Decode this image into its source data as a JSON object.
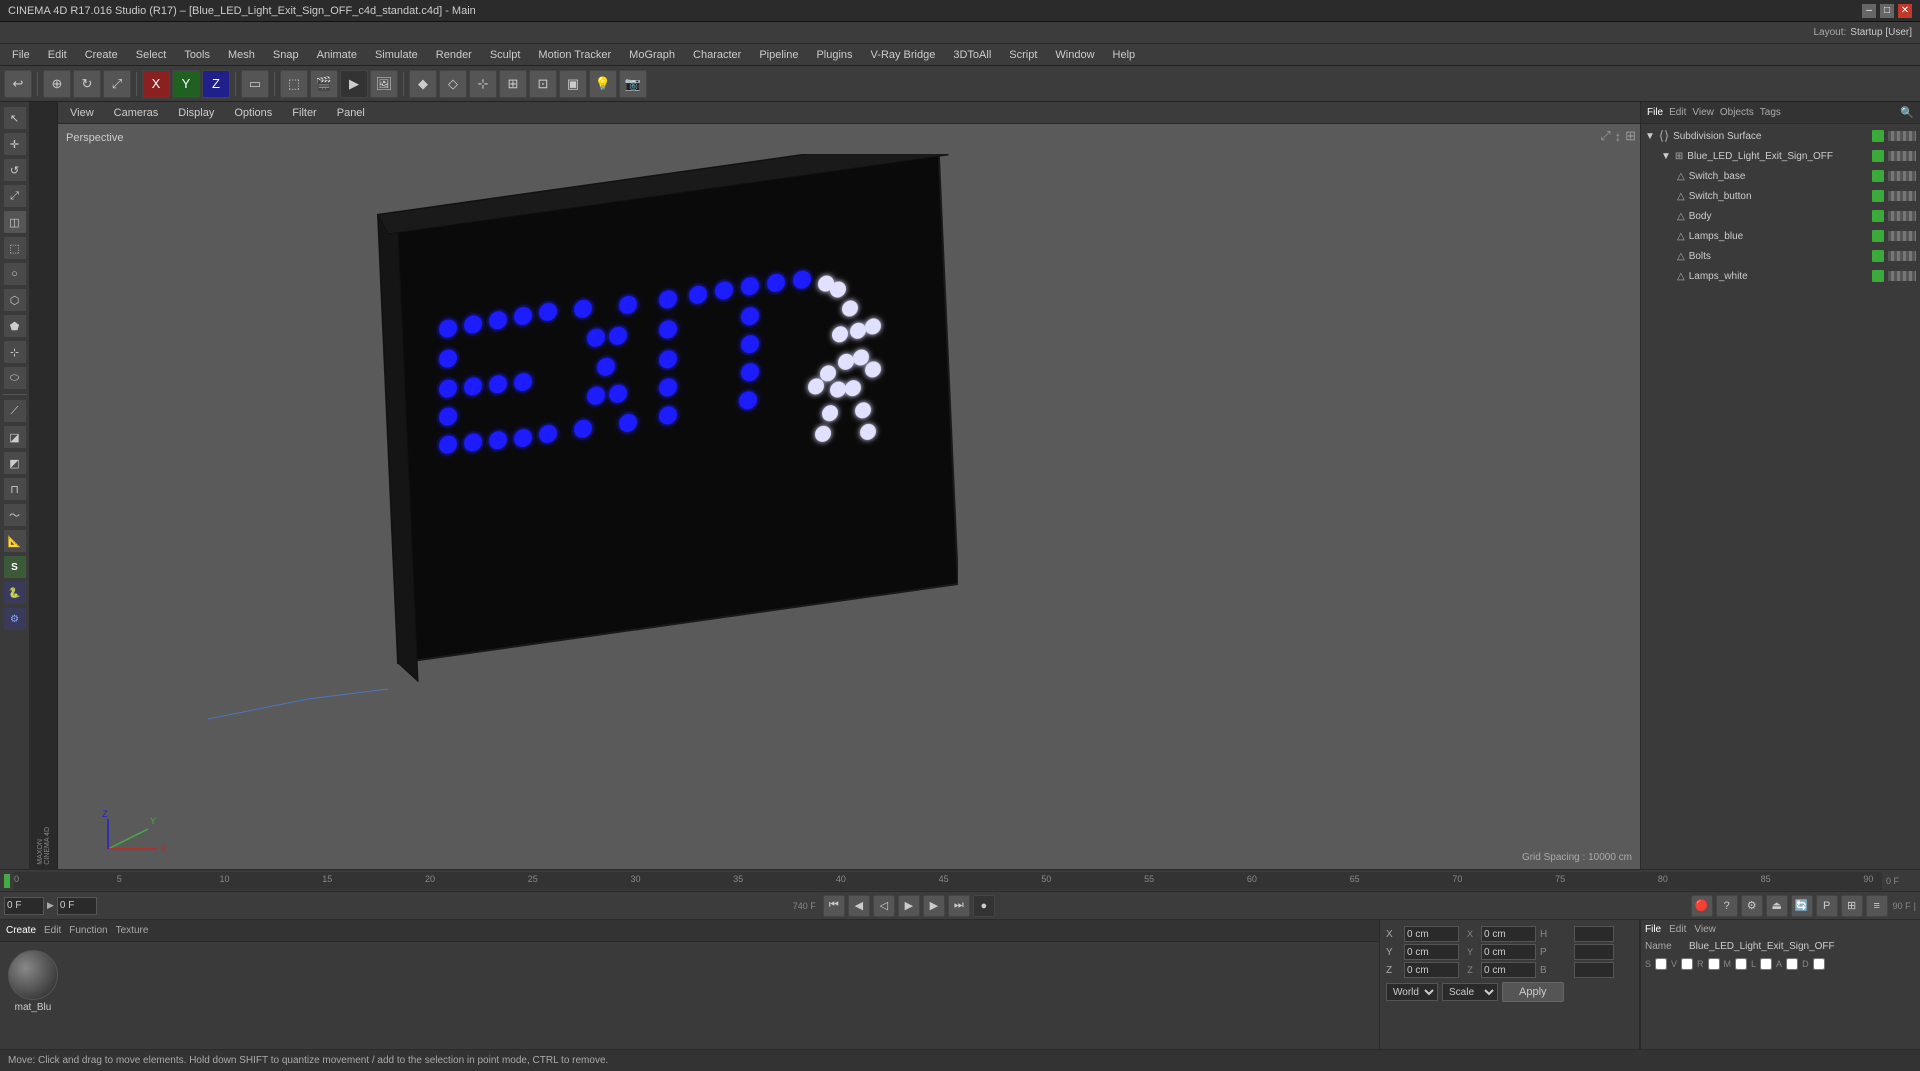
{
  "titlebar": {
    "title": "CINEMA 4D R17.016 Studio (R17) – [Blue_LED_Light_Exit_Sign_OFF_c4d_standat.c4d] - Main",
    "min_btn": "–",
    "max_btn": "□",
    "close_btn": "✕"
  },
  "menu": {
    "items": [
      "File",
      "Edit",
      "Create",
      "Select",
      "Tools",
      "Mesh",
      "Snap",
      "Animate",
      "Simulate",
      "Render",
      "Sculpt",
      "Motion Tracker",
      "MoGraph",
      "Character",
      "Pipeline",
      "Plugins",
      "V-Ray Bridge",
      "3DToAll",
      "Script",
      "Window",
      "Help"
    ]
  },
  "layout": {
    "label": "Layout:",
    "value": "Startup [User]"
  },
  "viewport": {
    "label": "Perspective",
    "menus": [
      "View",
      "Cameras",
      "Display",
      "Options",
      "Filter",
      "Panel"
    ],
    "grid_spacing": "Grid Spacing : 10000 cm"
  },
  "scene_tree": {
    "header_tabs": [
      "File",
      "Edit",
      "View",
      "Objects",
      "Tags"
    ],
    "items": [
      {
        "name": "Subdivision Surface",
        "indent": 0,
        "type": "group",
        "color": "#3aaa3a",
        "selected": false
      },
      {
        "name": "Blue_LED_Light_Exit_Sign_OFF",
        "indent": 1,
        "type": "object",
        "color": "#3aaa3a",
        "selected": false
      },
      {
        "name": "Switch_base",
        "indent": 2,
        "type": "object",
        "color": "#3aaa3a",
        "selected": false
      },
      {
        "name": "Switch_button",
        "indent": 2,
        "type": "object",
        "color": "#3aaa3a",
        "selected": false
      },
      {
        "name": "Body",
        "indent": 2,
        "type": "object",
        "color": "#3aaa3a",
        "selected": false
      },
      {
        "name": "Lamps_blue",
        "indent": 2,
        "type": "object",
        "color": "#3aaa3a",
        "selected": false
      },
      {
        "name": "Bolts",
        "indent": 2,
        "type": "object",
        "color": "#3aaa3a",
        "selected": false
      },
      {
        "name": "Lamps_white",
        "indent": 2,
        "type": "object",
        "color": "#3aaa3a",
        "selected": false
      }
    ]
  },
  "attrs_panel": {
    "tabs": [
      "File",
      "Edit",
      "View"
    ],
    "name_label": "Name",
    "name_value": "Blue_LED_Light_Exit_Sign_OFF",
    "checkboxes": [
      "S",
      "V",
      "R",
      "M",
      "L",
      "A",
      "D"
    ],
    "coords": [
      {
        "label": "X",
        "val1": "0 cm",
        "icon": "X",
        "val2": "0 cm",
        "extra": "H",
        "extra_val": ""
      },
      {
        "label": "Y",
        "val1": "0 cm",
        "icon": "Y",
        "val2": "0 cm",
        "extra": "P",
        "extra_val": ""
      },
      {
        "label": "Z",
        "val1": "0 cm",
        "icon": "Z",
        "val2": "0 cm",
        "extra": "B",
        "extra_val": ""
      }
    ],
    "dropdown1": "World",
    "dropdown2": "Scale",
    "apply_btn": "Apply"
  },
  "material_panel": {
    "tabs": [
      "Create",
      "Edit",
      "Function",
      "Texture"
    ],
    "mat_name": "mat_Blu"
  },
  "timeline": {
    "frame_start": "0 F",
    "frame_current": "0 F",
    "frame_end": "90 F",
    "ticks": [
      "0",
      "5",
      "10",
      "15",
      "20",
      "25",
      "30",
      "35",
      "40",
      "45",
      "50",
      "55",
      "60",
      "65",
      "70",
      "75",
      "80",
      "85",
      "90"
    ]
  },
  "statusbar": {
    "text": "Move: Click and drag to move elements. Hold down SHIFT to quantize movement / add to the selection in point mode, CTRL to remove."
  }
}
